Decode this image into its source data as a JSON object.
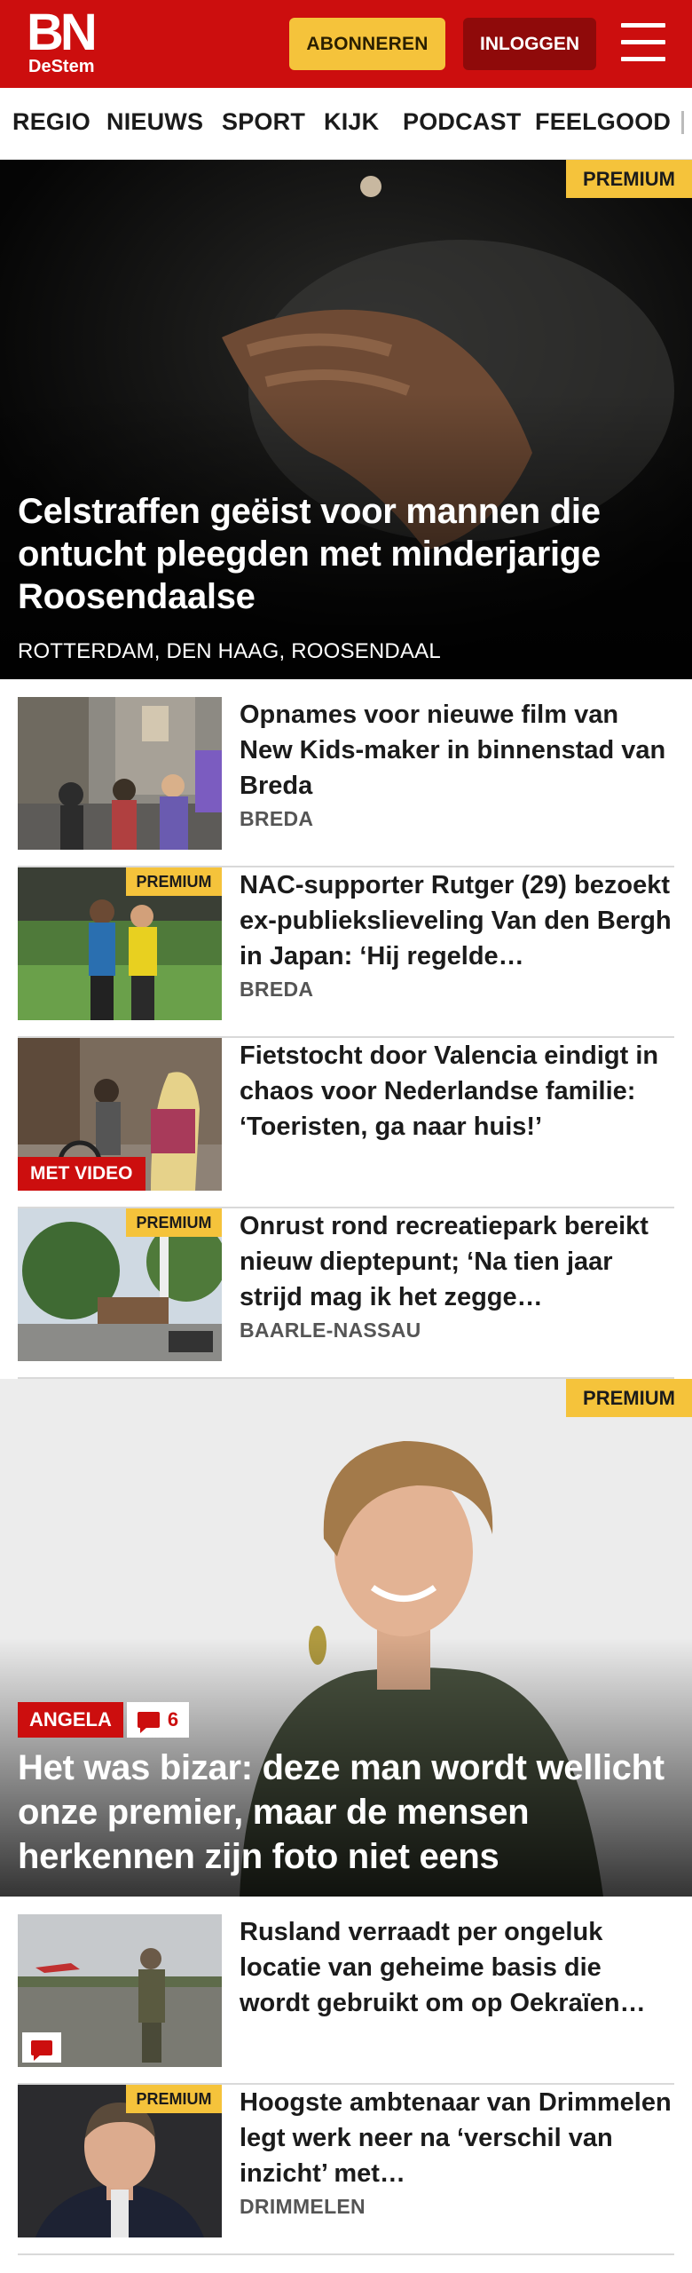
{
  "header": {
    "logo_main": "BN",
    "logo_sub": "DeStem",
    "subscribe_label": "ABONNEREN",
    "login_label": "INLOGGEN",
    "menu_icon": "hamburger-menu-icon",
    "brand_color": "#cc0e0e",
    "subscribe_color": "#f5c33b"
  },
  "nav": {
    "items": [
      "REGIO",
      "NIEUWS",
      "SPORT",
      "KIJK",
      "PODCAST",
      "FEELGOOD"
    ]
  },
  "hero": {
    "badge": "PREMIUM",
    "title": "Celstraffen geëist voor mannen die ontucht pleegden met minderjarige Roosendaalse",
    "location": "ROTTERDAM, DEN HAAG, ROOSENDAAL"
  },
  "articles": [
    {
      "title": "Opnames voor nieuwe film van New Kids-maker in binnenstad van Breda",
      "location": "BREDA"
    },
    {
      "badge": "PREMIUM",
      "title": "NAC-supporter Rutger (29) bezoekt ex-publiekslieveling Van den Bergh in Japan: ‘Hij regelde…",
      "location": "BREDA"
    },
    {
      "video_badge": "MET VIDEO",
      "title": "Fietstocht door Valencia eindigt in chaos voor Nederlandse familie: ‘Toeristen, ga naar huis!’"
    },
    {
      "badge": "PREMIUM",
      "title": "Onrust rond recreatiepark bereikt nieuw dieptepunt; ‘Na tien jaar strijd mag ik het zegge…",
      "location": "BAARLE-NASSAU"
    }
  ],
  "feature": {
    "badge": "PREMIUM",
    "tag": "ANGELA",
    "comment_count": "6",
    "comment_icon": "comment-bubble-icon",
    "title": "Het was bizar: deze man wordt wellicht onze premier, maar de mensen herkennen zijn foto niet eens"
  },
  "articles2": [
    {
      "comment_icon": "comment-bubble-icon",
      "title": "Rusland verraadt per ongeluk locatie van geheime basis die wordt gebruikt om op Oekraïen…"
    },
    {
      "badge": "PREMIUM",
      "title": "Hoogste ambtenaar van Drimmelen legt werk neer na ‘verschil van inzicht’ met…",
      "location": "DRIMMELEN"
    }
  ]
}
